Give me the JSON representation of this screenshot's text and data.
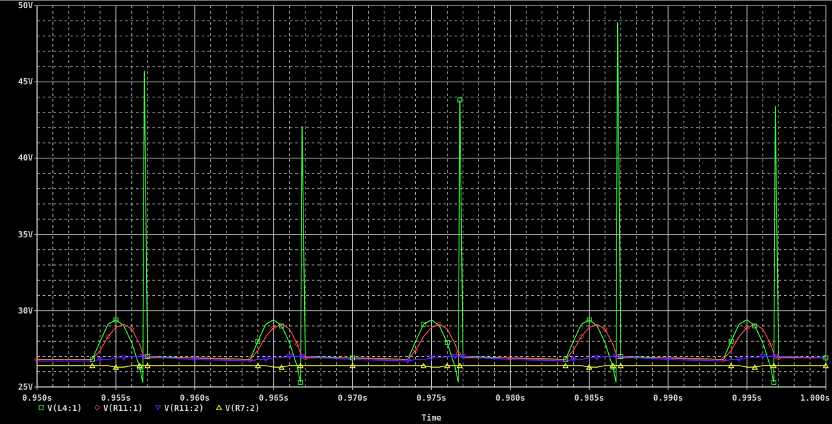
{
  "plot": {
    "chart_data": {
      "type": "line",
      "xlabel": "Time",
      "x": [
        0.95,
        0.9535,
        0.954,
        0.9545,
        0.955,
        0.9555,
        0.956,
        0.9565,
        0.9567,
        0.9568,
        0.957,
        0.96,
        0.9635,
        0.964,
        0.9645,
        0.965,
        0.9655,
        0.966,
        0.9665,
        0.9667,
        0.9668,
        0.967,
        0.97,
        0.9735,
        0.974,
        0.9745,
        0.975,
        0.9755,
        0.976,
        0.9765,
        0.9767,
        0.9768,
        0.977,
        0.98,
        0.9835,
        0.984,
        0.9845,
        0.985,
        0.9855,
        0.986,
        0.9865,
        0.9867,
        0.9868,
        0.987,
        0.99,
        0.9935,
        0.994,
        0.9945,
        0.995,
        0.9955,
        0.996,
        0.9965,
        0.9967,
        0.9968,
        0.997,
        1.0
      ],
      "series": [
        {
          "name": "V(L4:1)",
          "color": "#40ff40",
          "values": [
            26.8,
            26.8,
            28.0,
            29.1,
            29.4,
            29.0,
            27.9,
            26.3,
            25.3,
            45.7,
            27.0,
            26.9,
            26.8,
            28.0,
            29.1,
            29.4,
            29.0,
            27.9,
            26.3,
            25.3,
            42.1,
            27.0,
            26.9,
            26.8,
            28.0,
            29.1,
            29.4,
            29.0,
            27.9,
            26.3,
            25.3,
            43.8,
            27.0,
            26.9,
            26.8,
            28.0,
            29.1,
            29.4,
            29.0,
            27.9,
            26.3,
            25.3,
            48.9,
            27.0,
            26.9,
            26.8,
            28.0,
            29.1,
            29.4,
            29.0,
            27.9,
            26.3,
            25.3,
            43.4,
            27.0,
            26.9
          ]
        },
        {
          "name": "V(R11:1)",
          "color": "#ff5050",
          "values": [
            26.8,
            26.8,
            27.4,
            28.3,
            28.9,
            29.1,
            28.8,
            27.8,
            27.2,
            27.0,
            26.9,
            26.9,
            26.8,
            27.4,
            28.3,
            28.9,
            29.1,
            28.8,
            27.8,
            27.2,
            27.0,
            26.9,
            26.9,
            26.8,
            27.4,
            28.3,
            28.9,
            29.1,
            28.8,
            27.8,
            27.2,
            27.0,
            26.9,
            26.9,
            26.8,
            27.4,
            28.3,
            28.9,
            29.1,
            28.8,
            27.8,
            27.2,
            27.0,
            26.9,
            26.9,
            26.8,
            27.4,
            28.3,
            28.9,
            29.1,
            28.8,
            27.8,
            27.2,
            27.0,
            26.9,
            26.9
          ]
        },
        {
          "name": "V(R11:2)",
          "color": "#6020ff",
          "values": [
            26.7,
            26.7,
            26.8,
            26.8,
            26.9,
            26.9,
            27.0,
            27.0,
            27.0,
            27.0,
            27.0,
            26.8,
            26.7,
            26.8,
            26.8,
            26.9,
            26.9,
            27.0,
            27.0,
            27.0,
            27.0,
            27.0,
            26.8,
            26.7,
            26.8,
            26.8,
            26.9,
            26.9,
            27.0,
            27.0,
            27.0,
            27.0,
            27.0,
            26.8,
            26.7,
            26.8,
            26.8,
            26.9,
            26.9,
            27.0,
            27.0,
            27.0,
            27.0,
            27.0,
            26.8,
            26.7,
            26.8,
            26.8,
            26.9,
            26.9,
            27.0,
            27.0,
            27.0,
            27.0,
            27.0,
            26.9
          ]
        },
        {
          "name": "V(R7:2)",
          "color": "#ffff40",
          "values": [
            26.4,
            26.4,
            26.4,
            26.4,
            26.3,
            26.3,
            26.4,
            26.4,
            26.4,
            26.4,
            26.4,
            26.4,
            26.4,
            26.4,
            26.4,
            26.3,
            26.3,
            26.4,
            26.4,
            26.4,
            26.4,
            26.4,
            26.4,
            26.4,
            26.4,
            26.4,
            26.3,
            26.3,
            26.4,
            26.4,
            26.4,
            26.4,
            26.4,
            26.4,
            26.4,
            26.4,
            26.4,
            26.3,
            26.3,
            26.4,
            26.4,
            26.4,
            26.4,
            26.4,
            26.4,
            26.4,
            26.4,
            26.4,
            26.3,
            26.3,
            26.4,
            26.4,
            26.4,
            26.4,
            26.4,
            26.4
          ]
        }
      ],
      "grid": true,
      "legend": true,
      "xlim": [
        0.95,
        1.0
      ],
      "ylim": [
        25,
        50
      ],
      "xticks": [
        {
          "value": 0.95,
          "label": "0.950s"
        },
        {
          "value": 0.955,
          "label": "0.955s"
        },
        {
          "value": 0.96,
          "label": "0.960s"
        },
        {
          "value": 0.965,
          "label": "0.965s"
        },
        {
          "value": 0.97,
          "label": "0.970s"
        },
        {
          "value": 0.975,
          "label": "0.975s"
        },
        {
          "value": 0.98,
          "label": "0.980s"
        },
        {
          "value": 0.985,
          "label": "0.985s"
        },
        {
          "value": 0.99,
          "label": "0.990s"
        },
        {
          "value": 0.995,
          "label": "0.995s"
        },
        {
          "value": 1.0,
          "label": "1.000s"
        }
      ],
      "yticks": [
        {
          "value": 25,
          "label": "25V"
        },
        {
          "value": 30,
          "label": "30V"
        },
        {
          "value": 35,
          "label": "35V"
        },
        {
          "value": 40,
          "label": "40V"
        },
        {
          "value": 45,
          "label": "45V"
        },
        {
          "value": 50,
          "label": "50V"
        }
      ]
    }
  }
}
